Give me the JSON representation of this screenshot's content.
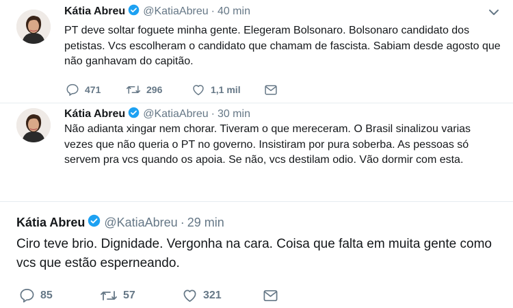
{
  "tweets": [
    {
      "name": "Kátia Abreu",
      "handle": "@KatiaAbreu",
      "separator": "·",
      "time": "40 min",
      "text": "PT deve soltar foguete minha gente. Elegeram Bolsonaro. Bolsonaro candidato dos petistas. Vcs escolheram o candidato que chamam de fascista. Sabiam desde agosto que não ganhavam do capitão.",
      "replies": "471",
      "retweets": "296",
      "likes": "1,1 mil"
    },
    {
      "name": "Kátia Abreu",
      "handle": "@KatiaAbreu",
      "separator": "·",
      "time": "30 min",
      "text": "Não adianta xingar nem chorar. Tiveram o que mereceram. O Brasil sinalizou varias vezes que não queria o PT no governo. Insistiram por pura soberba. As pessoas só servem pra vcs quando os apoia. Se não, vcs destilam  odio. Vão dormir com esta."
    },
    {
      "name": "Kátia Abreu",
      "handle": "@KatiaAbreu",
      "separator": "·",
      "time": "29 min",
      "text": "Ciro teve brio. Dignidade. Vergonha na cara. Coisa que falta em muita gente como vcs que estão esperneando.",
      "replies": "85",
      "retweets": "57",
      "likes": "321"
    }
  ],
  "colors": {
    "verified": "#1da1f2",
    "secondary_text": "#657786",
    "primary_text": "#14171a"
  },
  "icons": [
    "verified-badge-icon",
    "reply-icon",
    "retweet-icon",
    "like-icon",
    "dm-envelope-icon",
    "chevron-down-icon"
  ]
}
